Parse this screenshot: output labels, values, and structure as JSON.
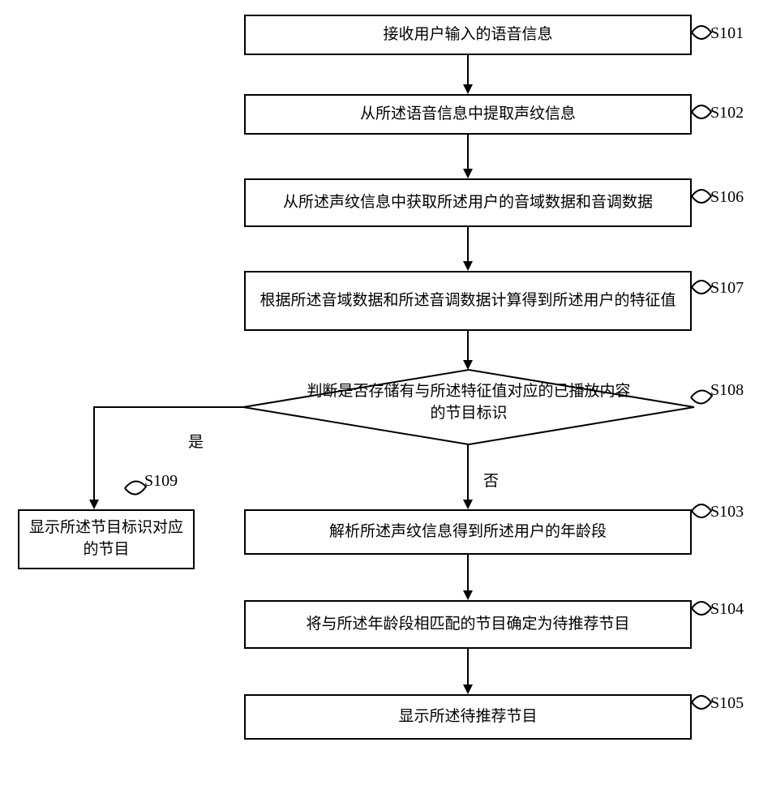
{
  "flowchart": {
    "steps": {
      "s101": {
        "id": "S101",
        "text": "接收用户输入的语音信息"
      },
      "s102": {
        "id": "S102",
        "text": "从所述语音信息中提取声纹信息"
      },
      "s106": {
        "id": "S106",
        "text": "从所述声纹信息中获取所述用户的音域数据和音调数据"
      },
      "s107": {
        "id": "S107",
        "text": "根据所述音域数据和所述音调数据计算得到所述用户的特征值"
      },
      "s108": {
        "id": "S108",
        "text": "判断是否存储有与所述特征值对应的已播放内容的节目标识"
      },
      "s109": {
        "id": "S109",
        "text": "显示所述节目标识对应的节目"
      },
      "s103": {
        "id": "S103",
        "text": "解析所述声纹信息得到所述用户的年龄段"
      },
      "s104": {
        "id": "S104",
        "text": "将与所述年龄段相匹配的节目确定为待推荐节目"
      },
      "s105": {
        "id": "S105",
        "text": "显示所述待推荐节目"
      }
    },
    "branches": {
      "yes": "是",
      "no": "否"
    }
  }
}
